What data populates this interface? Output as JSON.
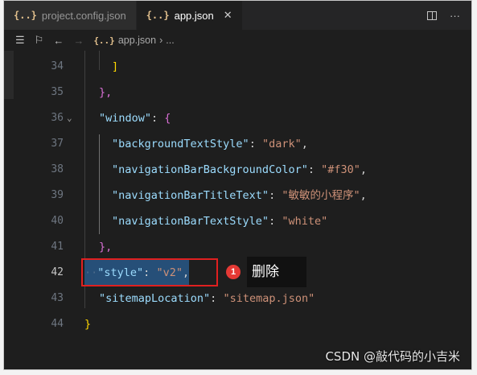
{
  "tabs": [
    {
      "icon": "{..}",
      "label": "project.config.json"
    },
    {
      "icon": "{..}",
      "label": "app.json",
      "close": "✕"
    }
  ],
  "breadcrumb": {
    "icon": "{..}",
    "file": "app.json",
    "sep": "›",
    "more": "..."
  },
  "lines": [
    {
      "num": "34",
      "text": "]"
    },
    {
      "num": "35",
      "text": "},"
    },
    {
      "num": "36",
      "key": "\"window\"",
      "sep": ": ",
      "text": "{"
    },
    {
      "num": "37",
      "key": "\"backgroundTextStyle\"",
      "sep": ": ",
      "value": "\"dark\"",
      "end": ","
    },
    {
      "num": "38",
      "key": "\"navigationBarBackgroundColor\"",
      "sep": ": ",
      "value": "\"#f30\"",
      "end": ","
    },
    {
      "num": "39",
      "key": "\"navigationBarTitleText\"",
      "sep": ": ",
      "value": "\"敏敏的小程序\"",
      "end": ","
    },
    {
      "num": "40",
      "key": "\"navigationBarTextStyle\"",
      "sep": ": ",
      "value": "\"white\""
    },
    {
      "num": "41",
      "text": "},"
    },
    {
      "num": "42",
      "key": "\"style\"",
      "sep": ": ",
      "value": "\"v2\"",
      "end": ","
    },
    {
      "num": "43",
      "key": "\"sitemapLocation\"",
      "sep": ": ",
      "value": "\"sitemap.json\""
    },
    {
      "num": "44",
      "text": "}"
    }
  ],
  "annotation": {
    "badge": "1",
    "text": "删除",
    "color": "#e53935"
  },
  "watermark": "CSDN @敲代码的小吉米"
}
